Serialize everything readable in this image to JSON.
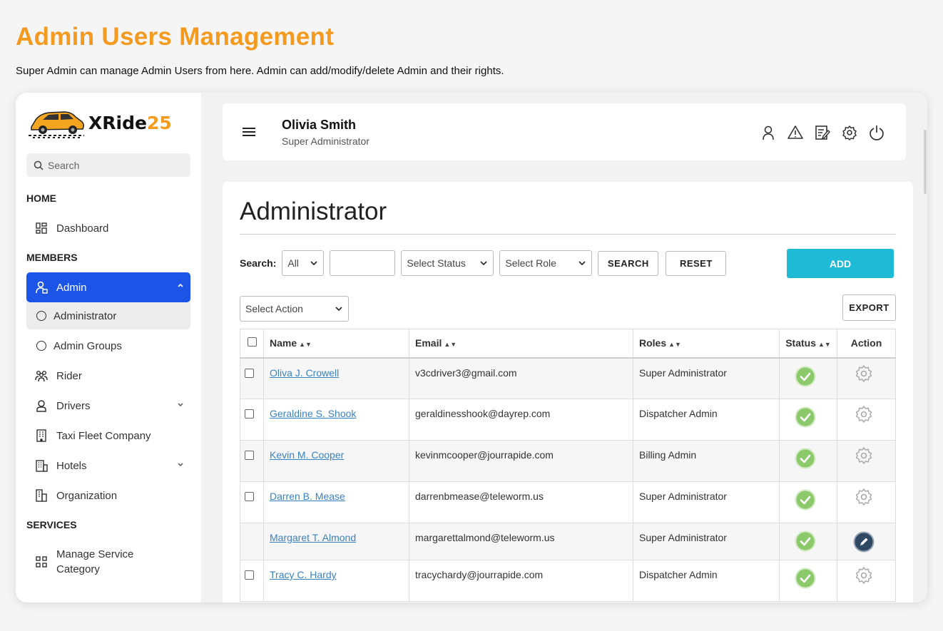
{
  "page": {
    "heading": "Admin Users Management",
    "description": "Super Admin can manage Admin Users from here. Admin can add/modify/delete Admin and their rights."
  },
  "logo": {
    "text_main": "XRide",
    "text_accent": "25"
  },
  "sidebar": {
    "search_placeholder": "Search",
    "sections": {
      "home": "HOME",
      "members": "MEMBERS",
      "services": "SERVICES"
    },
    "items": {
      "dashboard": "Dashboard",
      "admin": "Admin",
      "administrator": "Administrator",
      "admin_groups": "Admin Groups",
      "rider": "Rider",
      "drivers": "Drivers",
      "taxi_fleet": "Taxi Fleet Company",
      "hotels": "Hotels",
      "organization": "Organization",
      "manage_service_line1": "Manage Service",
      "manage_service_line2": "Category"
    }
  },
  "topbar": {
    "user_name": "Olivia Smith",
    "user_role": "Super Administrator"
  },
  "content": {
    "title": "Administrator",
    "search_label": "Search:",
    "filter_all": "All",
    "filter_status": "Select Status",
    "filter_role": "Select Role",
    "search_button": "SEARCH",
    "reset_button": "RESET",
    "add_button": "ADD",
    "action_select": "Select Action",
    "export_button": "EXPORT"
  },
  "table": {
    "headers": {
      "name": "Name",
      "email": "Email",
      "roles": "Roles",
      "status": "Status",
      "action": "Action"
    },
    "rows": [
      {
        "name": "Oliva J. Crowell",
        "email": "v3cdriver3@gmail.com",
        "role": "Super Administrator",
        "action": "settings"
      },
      {
        "name": "Geraldine S. Shook",
        "email": "geraldinesshook@dayrep.com",
        "role": "Dispatcher Admin",
        "action": "settings"
      },
      {
        "name": "Kevin M. Cooper",
        "email": "kevinmcooper@jourrapide.com",
        "role": "Billing Admin",
        "action": "settings"
      },
      {
        "name": "Darren B. Mease",
        "email": "darrenbmease@teleworm.us",
        "role": "Super Administrator",
        "action": "settings"
      },
      {
        "name": "Margaret T. Almond",
        "email": "margarettalmond@teleworm.us",
        "role": "Super Administrator",
        "action": "edit"
      },
      {
        "name": "Tracy C. Hardy",
        "email": "tracychardy@jourrapide.com",
        "role": "Dispatcher Admin",
        "action": "settings"
      }
    ]
  },
  "colors": {
    "heading": "#f39a1f",
    "active_nav": "#1c54e8",
    "add_button": "#1fbbd6",
    "status_ok": "#8cc96b",
    "edit_icon": "#2f4863"
  }
}
